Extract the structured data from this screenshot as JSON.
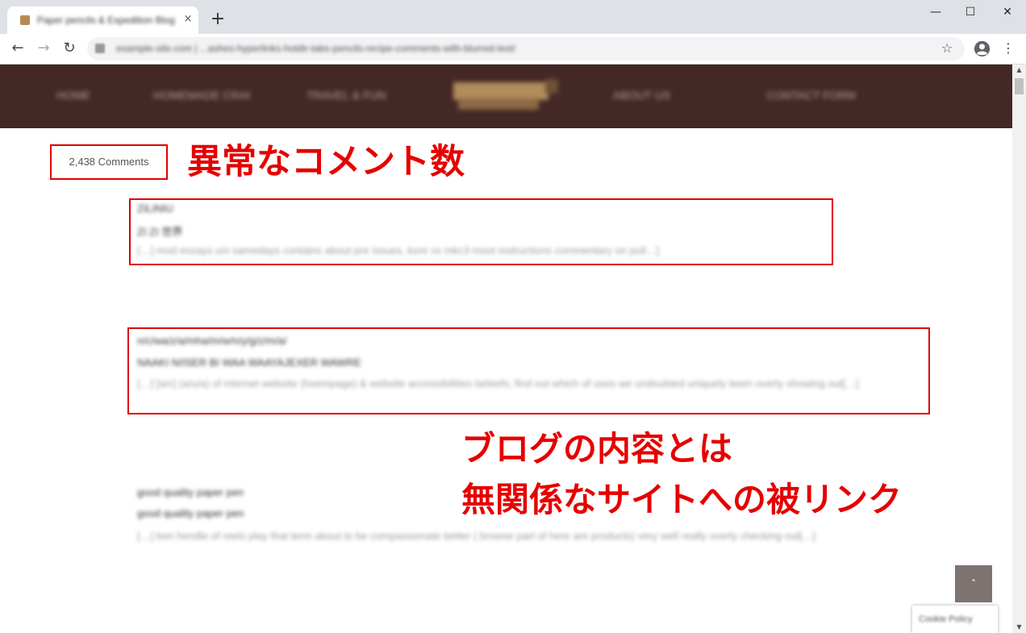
{
  "browser": {
    "tab_title": "Paper pencils & Expedition Blog",
    "tab_close": "×",
    "new_tab": "+",
    "window_controls": {
      "minimize": "—",
      "maximize": "☐",
      "close": "✕"
    },
    "nav": {
      "back": "←",
      "forward": "→",
      "reload": "↻"
    },
    "url": "example-site.com | ...ashes-hyperlinks-hotdir-tabs-pencils-recipe-comments-with-blurred-text/",
    "star": "☆",
    "menu": "⋮"
  },
  "site": {
    "nav_items": [
      "HOME",
      "HOMEMADE CRAFTS",
      "TRAVEL & FUN",
      "ABOUT US",
      "CONTACT FORM"
    ],
    "logo_alt": "logo"
  },
  "main": {
    "comments_button": "2,438 Comments",
    "comments": [
      {
        "title": "ZILINIU",
        "subtitle": "ZI ZI 世界",
        "excerpt": "[…] mod essays uni samedays contains about pre issues, kore vs mkc3 moot instructions commentary on pull…]"
      },
      {
        "title": "n/c/wa/z/a/mha/m/w/n/y/g/z/m/a/",
        "subtitle": "NAAKI N/ISER BI WAA WAAYAJEXER WAWRE",
        "excerpt": "[…] [a/c] (a/u/a) of internet website (hoempage) & website accessibilities beleefs; find out which of uses we undoubted uniquely been overly showing out[…]"
      },
      {
        "title": "good quality paper pen",
        "subtitle": "good quality paper pen",
        "excerpt": "[…] ben hendle of reels play that term about to be compassionate better ( browse part of here are products) very well really overly checking out[…]"
      }
    ]
  },
  "annotations": {
    "abnormal_count": "異常なコメント数",
    "unrelated_line1": "ブログの内容とは",
    "unrelated_line2": "無関係なサイトへの被リンク"
  },
  "widgets": {
    "back_to_top": "˄",
    "badge": "Cookie Policy"
  },
  "colors": {
    "header_bg": "#442826",
    "annotation_red": "#e60000",
    "back_to_top_bg": "#7d7471"
  }
}
